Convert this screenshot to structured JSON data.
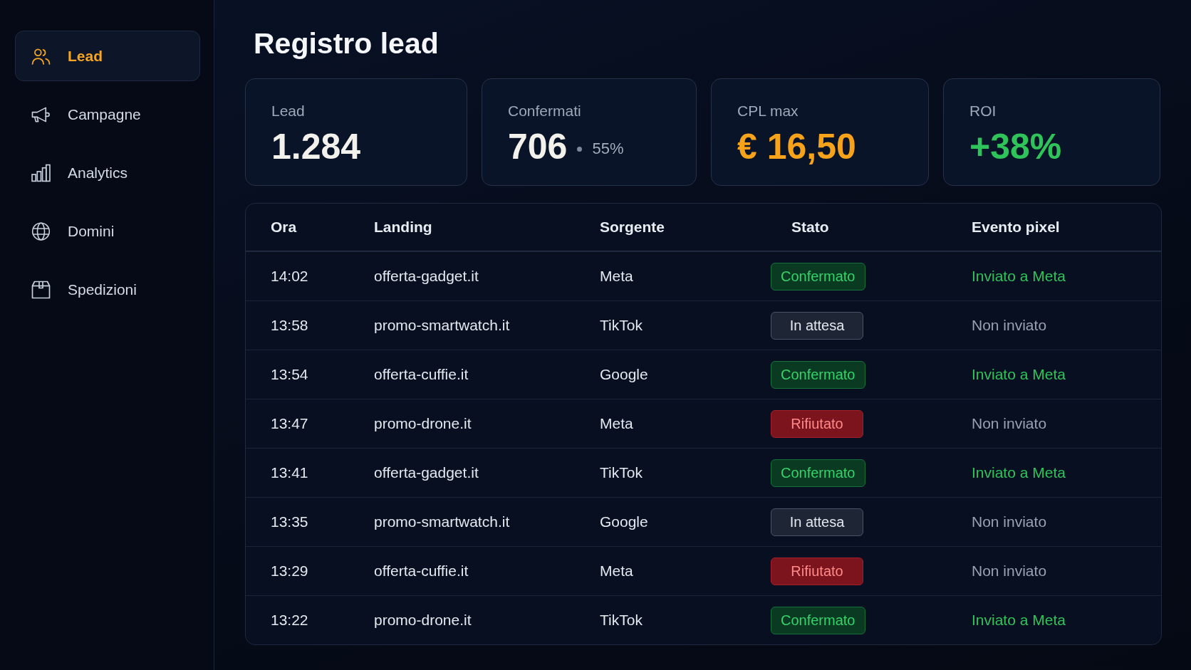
{
  "sidebar": {
    "items": [
      {
        "label": "Lead",
        "selected": true
      },
      {
        "label": "Campagne",
        "selected": false
      },
      {
        "label": "Analytics",
        "selected": false
      },
      {
        "label": "Domini",
        "selected": false
      },
      {
        "label": "Spedizioni",
        "selected": false
      }
    ]
  },
  "page_title": "Registro lead",
  "stats": [
    {
      "label": "Lead",
      "value": "1.284",
      "kind": "plain"
    },
    {
      "label": "Confermati",
      "value": "706",
      "detail": "55%",
      "kind": "plain"
    },
    {
      "label": "CPL max",
      "value": "€ 16,50",
      "kind": "warning"
    },
    {
      "label": "ROI",
      "value": "+38%",
      "kind": "positive"
    }
  ],
  "table": {
    "columns": [
      "Ora",
      "Landing",
      "Sorgente",
      "Stato",
      "Evento pixel"
    ],
    "rows": [
      {
        "time": "14:02",
        "landing": "offerta-gadget.it",
        "source": "Meta",
        "status": {
          "label": "Confermato",
          "kind": "confirmed"
        },
        "pixel_event": {
          "label": "Inviato a Meta",
          "sent": true
        }
      },
      {
        "time": "13:58",
        "landing": "promo-smartwatch.it",
        "source": "TikTok",
        "status": {
          "label": "In attesa",
          "kind": "pending"
        },
        "pixel_event": {
          "label": "Non inviato",
          "sent": false
        }
      },
      {
        "time": "13:54",
        "landing": "offerta-cuffie.it",
        "source": "Google",
        "status": {
          "label": "Confermato",
          "kind": "confirmed"
        },
        "pixel_event": {
          "label": "Inviato a Meta",
          "sent": true
        }
      },
      {
        "time": "13:47",
        "landing": "promo-drone.it",
        "source": "Meta",
        "status": {
          "label": "Rifiutato",
          "kind": "rejected"
        },
        "pixel_event": {
          "label": "Non inviato",
          "sent": false
        }
      },
      {
        "time": "13:41",
        "landing": "offerta-gadget.it",
        "source": "TikTok",
        "status": {
          "label": "Confermato",
          "kind": "confirmed"
        },
        "pixel_event": {
          "label": "Inviato a Meta",
          "sent": true
        }
      },
      {
        "time": "13:35",
        "landing": "promo-smartwatch.it",
        "source": "Google",
        "status": {
          "label": "In attesa",
          "kind": "pending"
        },
        "pixel_event": {
          "label": "Non inviato",
          "sent": false
        }
      },
      {
        "time": "13:29",
        "landing": "offerta-cuffie.it",
        "source": "Meta",
        "status": {
          "label": "Rifiutato",
          "kind": "rejected"
        },
        "pixel_event": {
          "label": "Non inviato",
          "sent": false
        }
      },
      {
        "time": "13:22",
        "landing": "promo-drone.it",
        "source": "TikTok",
        "status": {
          "label": "Confermato",
          "kind": "confirmed"
        },
        "pixel_event": {
          "label": "Inviato a Meta",
          "sent": true
        }
      }
    ]
  }
}
